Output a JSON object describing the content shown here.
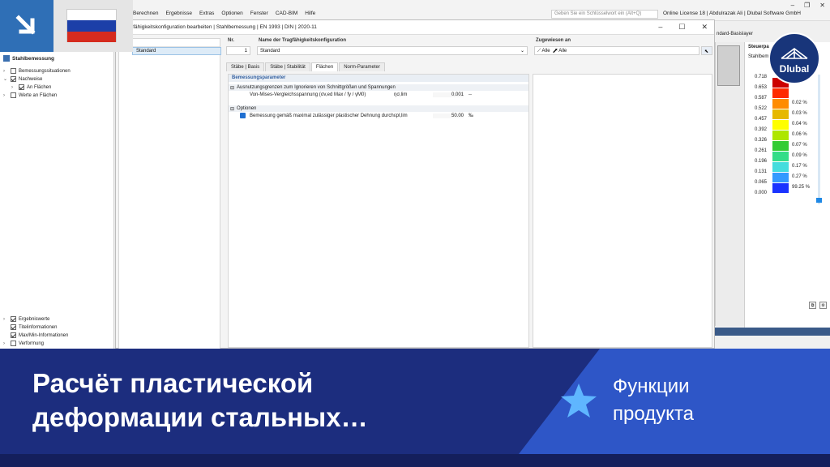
{
  "menu": {
    "items": [
      "Berechnen",
      "Ergebnisse",
      "Extras",
      "Optionen",
      "Fenster",
      "CAD-BIM",
      "Hilfe"
    ],
    "search_placeholder": "Geben Sie ein Schlüsselwort ein (Alt+Q)",
    "license": "Online License 18 | Abdulrazak Ali | Dlubal Software GmbH",
    "toolbar_right": "ndard-Basislayer"
  },
  "navigator": {
    "title": "Stahlbemessung",
    "items_top": [
      "Bemessungssituationen",
      "Nachweise",
      "An Flächen",
      "Werte an Flächen"
    ],
    "items_bottom": [
      "Ergebniswerte",
      "Titelinformationen",
      "Max/Min-Informationen",
      "Verformung"
    ]
  },
  "dialog": {
    "title": "agfähigkeitskonfiguration bearbeiten | Stahlbemessung | EN 1993 | DIN | 2020-11",
    "list_item": "Standard",
    "no_label": "Nr.",
    "no_value": "1",
    "name_label": "Name der Tragfähigkeitskonfiguration",
    "name_value": "Standard",
    "assigned_label": "Zugewiesen an",
    "assigned_1": "Alle",
    "assigned_2": "Alle",
    "tabs": [
      "Stäbe | Basis",
      "Stäbe | Stabilität",
      "Flächen",
      "Norm-Parameter"
    ],
    "params_header": "Bemessungsparameter",
    "group1": "Ausnutzungsgrenzen zum Ignorieren von Schnittgrößen und Spannungen",
    "row1_label": "Von-Mises-Vergleichsspannung (σv,ed Max / fy / γM0)",
    "row1_symbol": "ησ,lim",
    "row1_value": "0.001",
    "row1_unit": "--",
    "group2": "Optionen",
    "row2_label": "Bemessung gemäß maximal zulässiger plastischer Dehnung durch",
    "row2_symbol": "εpl,lim",
    "row2_value": "50.00",
    "row2_unit": "‰"
  },
  "legend": {
    "title": "Steuerpa",
    "subtitle": "Stahlbem",
    "values": [
      "0.718",
      "0.653",
      "0.587",
      "0.522",
      "0.457",
      "0.392",
      "0.326",
      "0.261",
      "0.196",
      "0.131",
      "0.065",
      "0.000"
    ],
    "colors": [
      "#cc0000",
      "#ff2a00",
      "#ff8c00",
      "#e6b800",
      "#ffff00",
      "#aee600",
      "#33cc33",
      "#33dd88",
      "#44dddd",
      "#3399ff",
      "#1a33ff",
      "#0a0aa8"
    ],
    "percents": [
      "",
      "",
      "0.02 %",
      "0.03 %",
      "0.04 %",
      "0.06 %",
      "0.07 %",
      "0.09 %",
      "0.17 %",
      "0.27 %",
      "99.25 %"
    ]
  },
  "badge": {
    "text": "Dlubal"
  },
  "banner": {
    "title_line1": "Расчёт пластической",
    "title_line2": "деформации стальных…",
    "tag_line1": "Функции",
    "tag_line2": "продукта"
  }
}
